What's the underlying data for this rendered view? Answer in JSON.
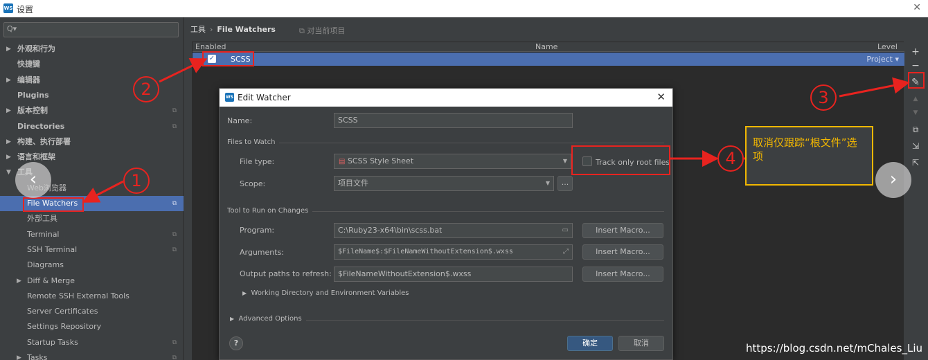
{
  "window": {
    "title": "设置",
    "close": "✕",
    "logo": "WS"
  },
  "search": {
    "placeholder": "Q▾"
  },
  "sidebar": {
    "items": [
      {
        "label": "外观和行为",
        "arrow": "▶",
        "bold": true
      },
      {
        "label": "快捷键",
        "bold": true
      },
      {
        "label": "编辑器",
        "arrow": "▶",
        "bold": true
      },
      {
        "label": "Plugins",
        "bold": true
      },
      {
        "label": "版本控制",
        "arrow": "▶",
        "bold": true,
        "badge": "⧉"
      },
      {
        "label": "Directories",
        "bold": true,
        "badge": "⧉"
      },
      {
        "label": "构建、执行部署",
        "arrow": "▶",
        "bold": true
      },
      {
        "label": "语言和框架",
        "arrow": "▶",
        "bold": true
      },
      {
        "label": "工具",
        "arrow": "▼",
        "bold": true
      },
      {
        "label": "Web浏览器"
      },
      {
        "label": "File Watchers",
        "selected": true,
        "badge": "⧉"
      },
      {
        "label": "外部工具"
      },
      {
        "label": "Terminal",
        "badge": "⧉"
      },
      {
        "label": "SSH Terminal",
        "badge": "⧉"
      },
      {
        "label": "Diagrams"
      },
      {
        "label": "Diff & Merge",
        "arrow": "▶"
      },
      {
        "label": "Remote SSH External Tools"
      },
      {
        "label": "Server Certificates"
      },
      {
        "label": "Settings Repository"
      },
      {
        "label": "Startup Tasks",
        "badge": "⧉"
      },
      {
        "label": "Tasks",
        "arrow": "▶",
        "badge": "⧉"
      }
    ]
  },
  "main": {
    "breadcrumb_root": "工具",
    "breadcrumb_sep": "›",
    "breadcrumb_current": "File Watchers",
    "scope_note": "⧉ 对当前项目",
    "table": {
      "headers": {
        "enabled": "Enabled",
        "name": "Name",
        "level": "Level"
      },
      "rows": [
        {
          "checked": "✓",
          "name": "SCSS",
          "level": "Project ▾"
        }
      ]
    },
    "tools": {
      "add": "+",
      "remove": "−",
      "edit": "✎",
      "up": "▲",
      "down": "▼",
      "copy": "⧉",
      "import": "⇲",
      "export": "⇱"
    }
  },
  "dialog": {
    "logo": "WS",
    "title": "Edit Watcher",
    "close": "✕",
    "name_label": "Name:",
    "name_value": "SCSS",
    "files_to_watch": "Files to Watch",
    "file_type_label": "File type:",
    "file_type_value": "SCSS Style Sheet",
    "track_root_label": "Track only root files",
    "scope_label": "Scope:",
    "scope_value": "项目文件",
    "scope_more": "...",
    "tool_section": "Tool to Run on Changes",
    "program_label": "Program:",
    "program_value": "C:\\Ruby23-x64\\bin\\scss.bat",
    "arguments_label": "Arguments:",
    "arguments_value": "$FileName$:$FileNameWithoutExtension$.wxss",
    "output_label": "Output paths to refresh:",
    "output_value": "$FileNameWithoutExtension$.wxss",
    "insert_macro": "Insert Macro...",
    "working_dir": "Working Directory and Environment Variables",
    "advanced": "Advanced Options",
    "ok": "确定",
    "cancel": "取消",
    "help": "?"
  },
  "annotations": {
    "n1": "1",
    "n2": "2",
    "n3": "3",
    "n4": "4",
    "note": "取消仅跟踪“根文件”选项",
    "prev": "‹",
    "next": "›",
    "accent": "#e8231f",
    "note_color": "#f2b701"
  },
  "watermark": "https://blog.csdn.net/mChales_Liu"
}
